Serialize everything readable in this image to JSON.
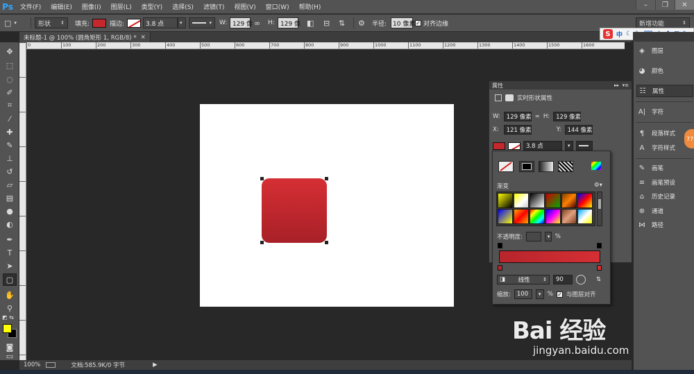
{
  "app": {
    "logo": "Ps"
  },
  "menu": [
    "文件(F)",
    "编辑(E)",
    "图像(I)",
    "图层(L)",
    "类型(Y)",
    "选择(S)",
    "滤镜(T)",
    "视图(V)",
    "窗口(W)",
    "帮助(H)"
  ],
  "window_controls": {
    "minimize": "–",
    "restore": "❐",
    "close": "✕"
  },
  "options": {
    "mode": "形状",
    "fill_label": "填充:",
    "stroke_label": "描边:",
    "stroke_width": "3.8 点",
    "w_label": "W:",
    "w_value": "129 像",
    "h_label": "H:",
    "h_value": "129 像",
    "radius_label": "半径:",
    "radius_value": "10 像素",
    "align_edges": "对齐边缘",
    "workspace": "新增功能"
  },
  "ime": {
    "logo": "S",
    "lang": "中"
  },
  "document": {
    "tab_title": "未标题-1 @ 100% (圆角矩形 1, RGB/8) *",
    "close": "×"
  },
  "ruler": {
    "h": [
      "0",
      "100",
      "200",
      "300",
      "400",
      "500",
      "600",
      "700",
      "800",
      "900",
      "1000",
      "1100",
      "1200",
      "1300",
      "1400",
      "1500",
      "1600"
    ]
  },
  "status": {
    "zoom": "100%",
    "doc_info": "文档:585.9K/0 字节"
  },
  "dock": {
    "items": [
      "图层",
      "颜色",
      "属性",
      "字符",
      "段落样式",
      "字符样式",
      "画笔",
      "画笔预设",
      "历史记录",
      "通道",
      "路径"
    ],
    "badge": "77"
  },
  "properties": {
    "title": "属性",
    "section": "实时形状属性",
    "w_label": "W:",
    "w_value": "129 像素",
    "h_label": "H:",
    "h_value": "129 像素",
    "x_label": "X:",
    "x_value": "121 像素",
    "y_label": "Y:",
    "y_value": "144 像素",
    "stroke_width": "3.8 点"
  },
  "gradient_picker": {
    "preset_label": "渐变",
    "opacity_label": "不透明度:",
    "opacity_value": "",
    "percent": "%",
    "style": "线性",
    "angle": "90",
    "scale_label": "缩放:",
    "scale_value": "100",
    "align_label": "与图层对齐",
    "colors": {
      "start": "#b7252b",
      "end": "#d52f34"
    }
  },
  "watermark": {
    "logo": "Bai 经验",
    "url": "jingyan.baidu.com"
  }
}
